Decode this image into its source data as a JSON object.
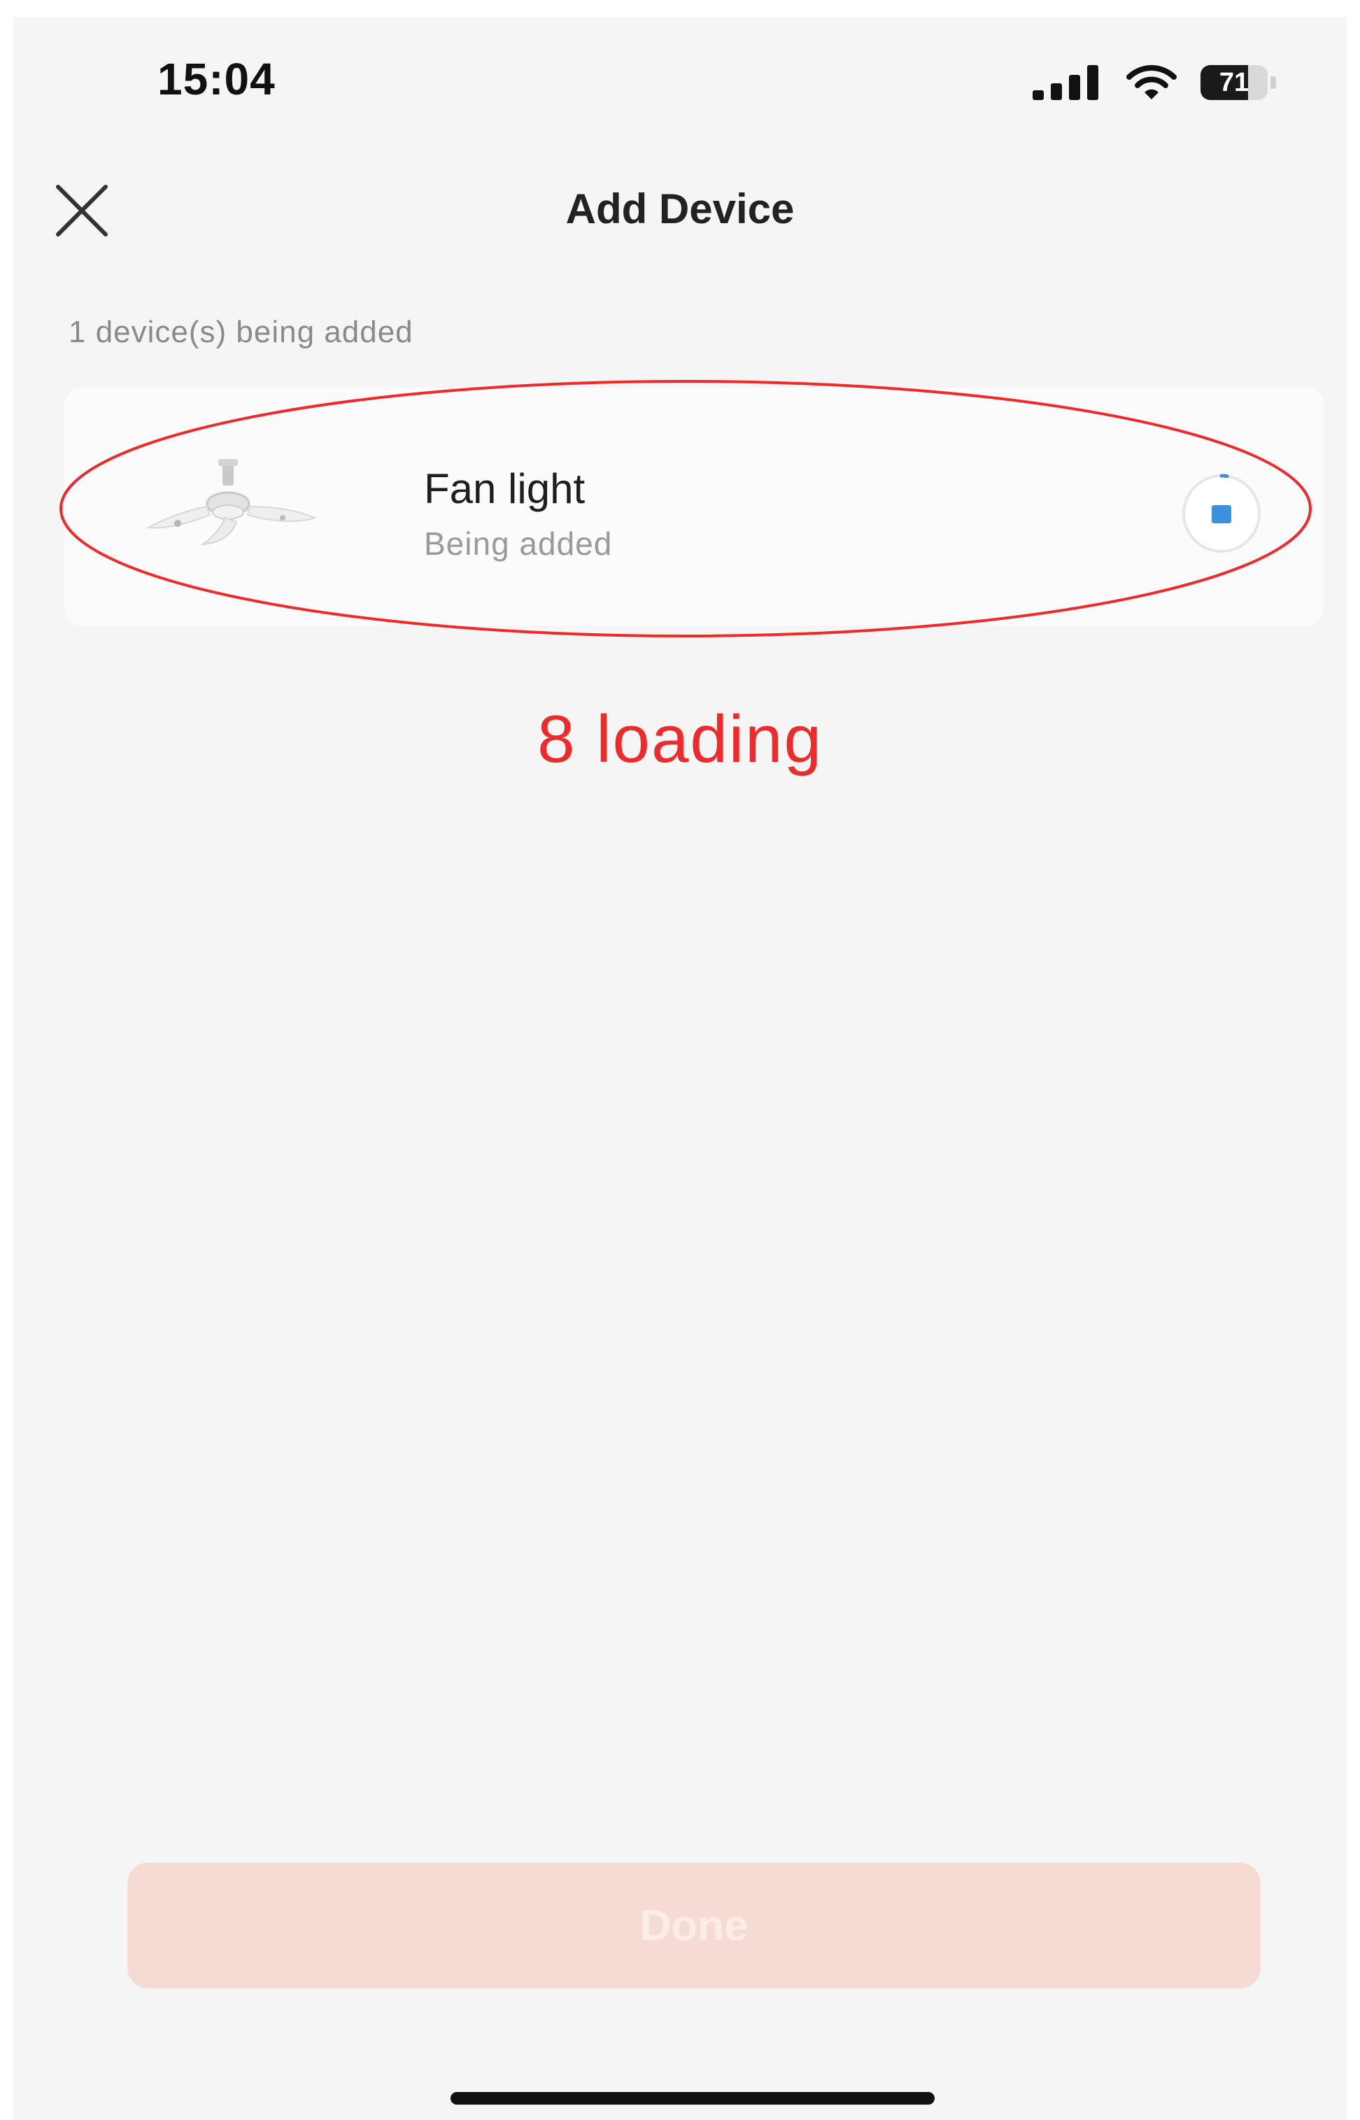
{
  "status_bar": {
    "time": "15:04",
    "battery_level": "71",
    "battery_percent": 71,
    "icons": [
      "signal-icon",
      "wifi-icon",
      "battery-icon"
    ]
  },
  "header": {
    "title": "Add Device",
    "close_icon": "close-icon"
  },
  "section": {
    "label": "1 device(s) being added"
  },
  "device": {
    "name": "Fan light",
    "status": "Being added",
    "thumbnail_icon": "fan-light-icon",
    "progress_icon": "progress-spinner-icon"
  },
  "annotation": {
    "text": "8 loading",
    "color": "#ee2a2a"
  },
  "footer": {
    "done_label": "Done"
  },
  "colors": {
    "background": "#f5f5f6",
    "card": "#fbfbfb",
    "accent_blue": "#3d8fe0",
    "done_button_bg": "#f6dbd5",
    "annotation_red": "#ee2a2a"
  }
}
